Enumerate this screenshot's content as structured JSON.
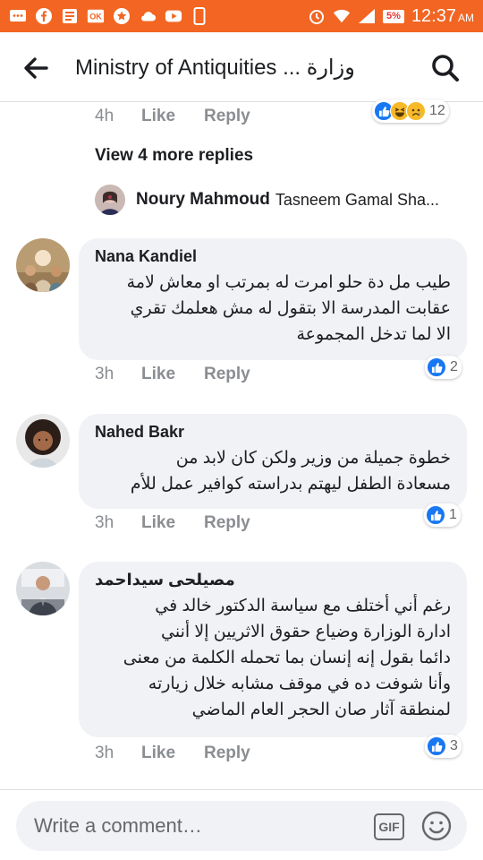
{
  "status_bar": {
    "battery": "5%",
    "time": "12:37",
    "ampm": "AM",
    "icons": [
      "message-icon",
      "facebook-icon",
      "news-icon",
      "ok-icon",
      "star-icon",
      "cloud-icon",
      "youtube-icon",
      "phone-icon",
      "alarm-icon",
      "wifi-icon",
      "signal-icon",
      "battery-icon"
    ]
  },
  "header": {
    "title": "Ministry of Antiquities ... وزارة"
  },
  "actions": {
    "like": "Like",
    "reply": "Reply"
  },
  "top_comment": {
    "time": "4h",
    "reaction_count": "12",
    "reactions": [
      "like-reaction-icon",
      "haha-reaction-icon",
      "sad-reaction-icon"
    ]
  },
  "view_replies": "View 4 more replies",
  "reply_preview": {
    "name": "Noury Mahmoud",
    "text": "Tasneem Gamal Sha..."
  },
  "comments": [
    {
      "author": "Nana Kandiel",
      "lines": [
        "طيب مل دة حلو امرت له بمرتب او معاش لامة",
        "عقابت المدرسة الا بتقول له مش هعلمك تقري",
        "الا لما تدخل المجموعة"
      ],
      "time": "3h",
      "reaction_count": "2"
    },
    {
      "author": "Nahed Bakr",
      "lines": [
        "خطوة جميلة  من وزير ولكن كان لابد من",
        "مسعادة الطفل ليهتم  بدراسته كوافير عمل للأم"
      ],
      "time": "3h",
      "reaction_count": "1"
    },
    {
      "author": "مصيلحى سيداحمد",
      "lines": [
        "رغم أني أختلف مع سياسة الدكتور خالد في",
        "ادارة الوزارة وضياع حقوق الاثريين إلا أنني",
        "دائما بقول إنه إنسان بما تحمله الكلمة من معنى",
        "وأنا شوفت ده في موقف مشابه خلال زيارته",
        "لمنطقة آثار صان الحجر العام الماضي"
      ],
      "time": "3h",
      "reaction_count": "3"
    }
  ],
  "composer": {
    "placeholder": "Write a comment…",
    "gif_label": "GIF"
  },
  "colors": {
    "status_bar": "#f26522",
    "bubble": "#f0f2f5",
    "meta_text": "#8a8d91",
    "like_blue": "#1877f2"
  }
}
